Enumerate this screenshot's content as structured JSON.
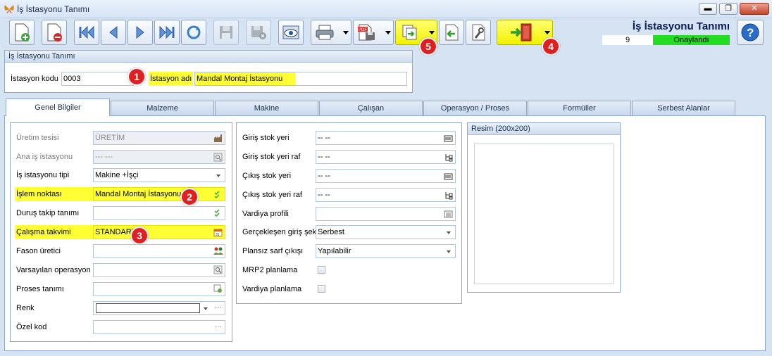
{
  "window": {
    "title": "İş İstasyonu Tanımı",
    "minimize": "▬",
    "maximize": "❐",
    "close": "✕"
  },
  "toolbar": {
    "form_title": "İş İstasyonu Tanımı",
    "record_no": "9",
    "status": "Onaylandı",
    "buttons": [
      "new-document-icon",
      "delete-document-icon",
      "first-record-icon",
      "previous-record-icon",
      "next-record-icon",
      "last-record-icon",
      "refresh-icon",
      "save-disabled-icon",
      "save-close-disabled-icon",
      "preview-icon",
      "print-icon",
      "export-pdf-icon",
      "transfer-icon",
      "back-icon",
      "tools-icon",
      "exit-icon",
      "help-icon"
    ],
    "highlight_color": "#f4f400",
    "status_color": "#22dd22"
  },
  "badges": {
    "b1": "1",
    "b2": "2",
    "b3": "3",
    "b4": "4",
    "b5": "5"
  },
  "header_group": {
    "title": "İş İstasyonu Tanımı",
    "code_label": "İstasyon kodu",
    "code_value": "0003",
    "name_label": "İstasyon adı",
    "name_value": "Mandal Montaj İstasyonu"
  },
  "tabs": [
    "Genel Bilgiler",
    "Malzeme",
    "Makine",
    "Çalışan",
    "Operasyon / Proses",
    "Formüller",
    "Serbest Alanlar"
  ],
  "left_panel": {
    "uretim_label": "Üretim tesisi",
    "uretim_value": "ÜRETİM",
    "ana_label": "Ana iş istasyonu",
    "ana_value": "--- ---",
    "tip_label": "İş istasyonu tipi",
    "tip_value": "Makine +İşçi",
    "islem_label": "İşlem noktası",
    "islem_value": "Mandal Montaj İstasyonu",
    "durus_label": "Duruş takip tanımı",
    "durus_value": "",
    "takvim_label": "Çalışma takvimi",
    "takvim_value": "STANDART",
    "fason_label": "Fason üretici",
    "fason_value": "",
    "operasyon_label": "Varsayılan operasyon",
    "operasyon_value": "",
    "proses_label": "Proses tanımı",
    "proses_value": "",
    "renk_label": "Renk",
    "renk_value": "",
    "ozel_label": "Özel kod",
    "ozel_value": ""
  },
  "middle_panel": {
    "giris_label": "Giriş stok yeri",
    "giris_value": "-- --",
    "giris_raf_label": "Giriş stok yeri raf",
    "giris_raf_value": "-- --",
    "cikis_label": "Çıkış stok yeri",
    "cikis_value": "-- --",
    "cikis_raf_label": "Çıkış stok yeri raf",
    "cikis_raf_value": "-- --",
    "vardiya_label": "Vardiya profili",
    "vardiya_value": "",
    "gecek_label": "Gerçekleşen giriş şekli",
    "gecek_value": "Serbest",
    "plansiz_label": "Plansız sarf çıkışı",
    "plansiz_value": "Yapılabilir",
    "mrp_label": "MRP2 planlama",
    "mrp_checked": false,
    "vardiya_plan_label": "Vardiya planlama",
    "vardiya_plan_checked": false
  },
  "image_panel": {
    "title": "Resim (200x200)"
  }
}
